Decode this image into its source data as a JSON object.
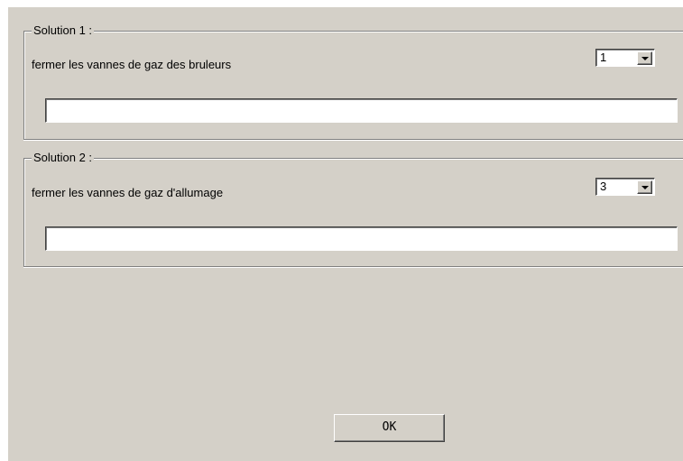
{
  "solutions": [
    {
      "legend": "Solution 1 :",
      "description": "fermer les vannes de gaz des bruleurs",
      "selected_value": "1",
      "text_value": ""
    },
    {
      "legend": "Solution 2 :",
      "description": "fermer les vannes de gaz d'allumage",
      "selected_value": "3",
      "text_value": ""
    }
  ],
  "ok_label": "OK",
  "icons": {
    "dropdown": "chevron-down-icon"
  },
  "colors": {
    "dialog_background": "#d4d0c8",
    "field_background": "#ffffff",
    "shadow": "#808080"
  }
}
